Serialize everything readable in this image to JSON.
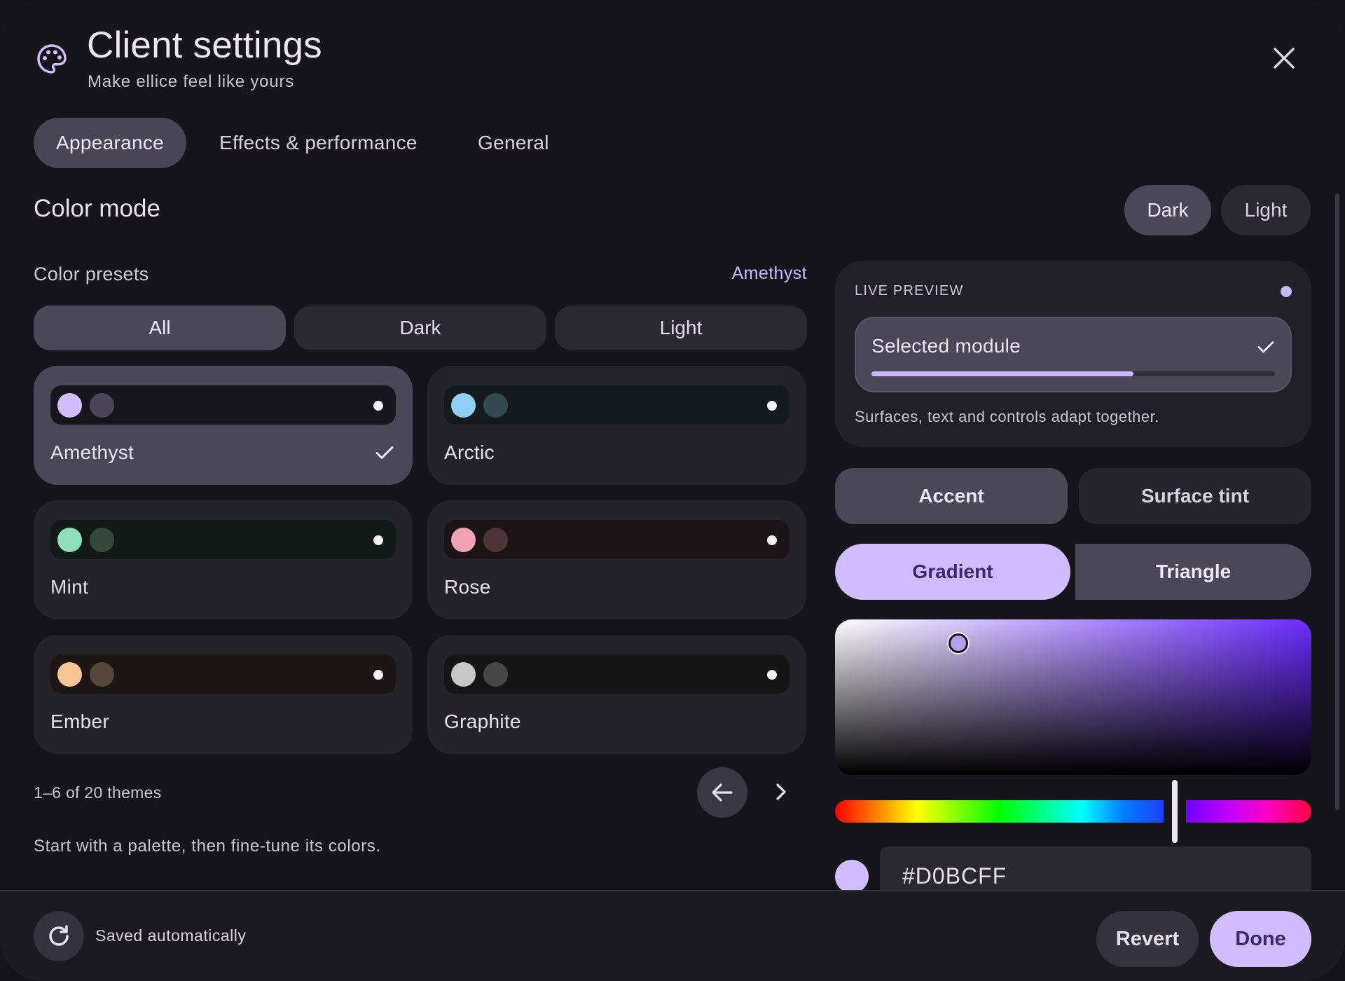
{
  "header": {
    "icon": "palette-icon",
    "title": "Client settings",
    "subtitle": "Make ellice feel like yours",
    "close_icon": "close-icon"
  },
  "tabs": [
    {
      "label": "Appearance",
      "active": true
    },
    {
      "label": "Effects & performance",
      "active": false
    },
    {
      "label": "General",
      "active": false
    }
  ],
  "color_mode": {
    "title": "Color mode",
    "options": [
      "Dark",
      "Light"
    ],
    "selected": "Dark"
  },
  "presets": {
    "label": "Color presets",
    "current": "Amethyst",
    "filters": [
      {
        "label": "All",
        "active": true
      },
      {
        "label": "Dark",
        "active": false
      },
      {
        "label": "Light",
        "active": false
      }
    ],
    "themes": [
      {
        "name": "Amethyst",
        "selected": true,
        "primary": "#d0bcff",
        "secondary": "#4a4458",
        "bar": "#17161c"
      },
      {
        "name": "Arctic",
        "selected": false,
        "primary": "#8fd0f5",
        "secondary": "#334850",
        "bar": "#151a1e"
      },
      {
        "name": "Mint",
        "selected": false,
        "primary": "#8fdfb8",
        "secondary": "#33493e",
        "bar": "#141a17"
      },
      {
        "name": "Rose",
        "selected": false,
        "primary": "#f2a1b7",
        "secondary": "#4e3439",
        "bar": "#1d1418"
      },
      {
        "name": "Ember",
        "selected": false,
        "primary": "#f7c597",
        "secondary": "#56463a",
        "bar": "#1c1714"
      },
      {
        "name": "Graphite",
        "selected": false,
        "primary": "#c8c8c8",
        "secondary": "#474747",
        "bar": "#161616"
      }
    ],
    "check_icon": "check-icon",
    "pager_text": "1–6 of 20 themes",
    "prev_icon": "arrow-left-icon",
    "next_icon": "chevron-right-icon",
    "hint": "Start with a palette, then fine-tune its colors."
  },
  "preview": {
    "label": "LIVE PREVIEW",
    "module_name": "Selected module",
    "progress": 0.65,
    "description": "Surfaces, text and controls adapt together."
  },
  "target_tabs": [
    {
      "label": "Accent",
      "active": true
    },
    {
      "label": "Surface tint",
      "active": false
    }
  ],
  "picker_tabs": [
    {
      "label": "Gradient",
      "active": true
    },
    {
      "label": "Triangle",
      "active": false
    }
  ],
  "picker": {
    "hex_value": "#D0BCFF",
    "swatch_color": "#d0bcff"
  },
  "footer": {
    "saved_text": "Saved automatically",
    "sync_icon": "refresh-icon",
    "revert_label": "Revert",
    "done_label": "Done"
  },
  "colors": {
    "accent": "#d0bcff",
    "surface": "#16151b"
  }
}
